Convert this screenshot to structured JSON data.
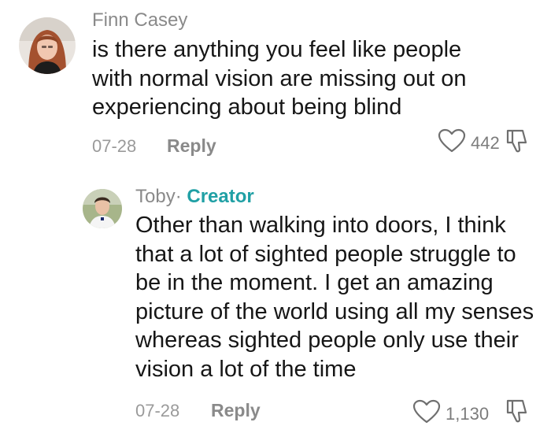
{
  "comments": [
    {
      "author": "Finn Casey",
      "text": "is there anything you feel like people with normal vision are missing out on experiencing about being blind",
      "date": "07-28",
      "reply_label": "Reply",
      "likes": "442",
      "avatar": "avatar-photo"
    },
    {
      "author": "Toby",
      "separator": "·",
      "badge": "Creator",
      "text": "Other than walking into doors, I think that a lot of sighted people struggle to be in the moment. I get an amazing picture of the world using all my senses whereas sighted people only use their vision a lot of the time",
      "date": "07-28",
      "reply_label": "Reply",
      "likes": "1,130",
      "avatar": "avatar-photo"
    }
  ],
  "icons": {
    "like": "heart-outline-icon",
    "dislike": "thumbs-down-outline-icon"
  },
  "colors": {
    "creator": "#20a0a5",
    "text": "#161616",
    "muted": "#8a8a8a"
  }
}
